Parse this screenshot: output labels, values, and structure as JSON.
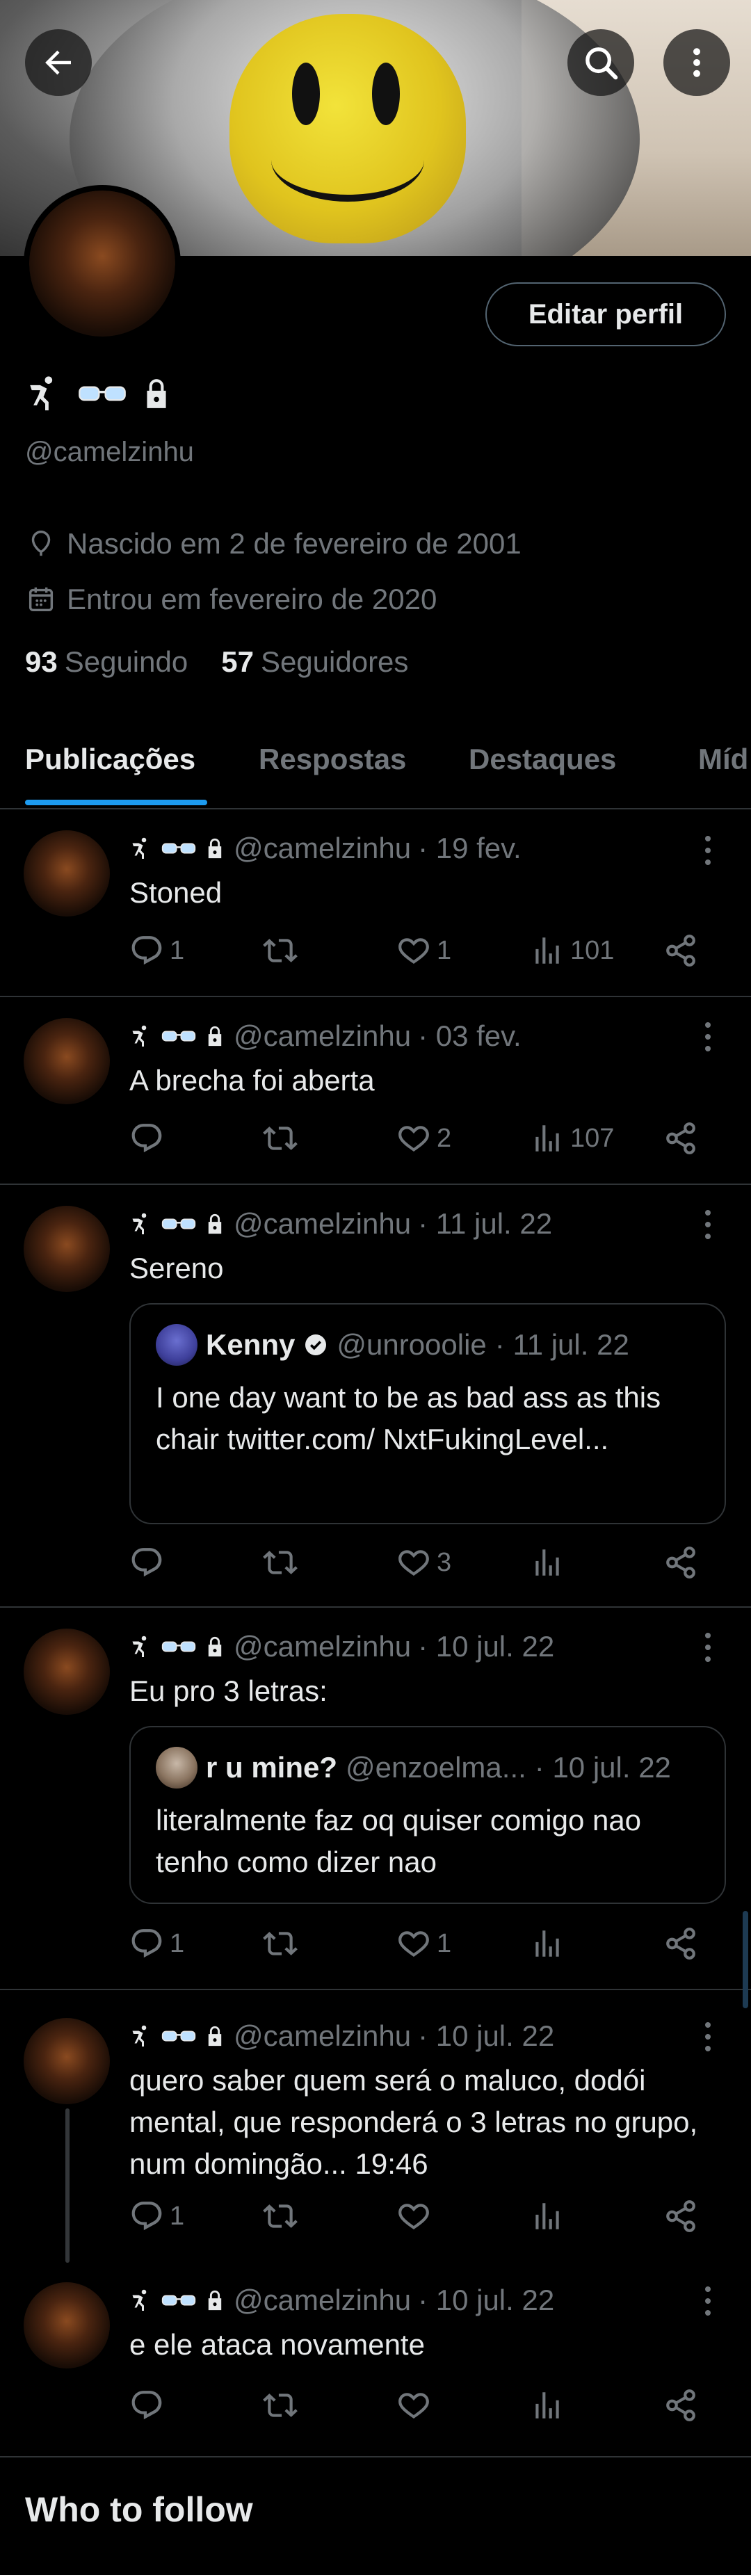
{
  "profile": {
    "display_name_icons": [
      "person-run-icon",
      "glasses-icon",
      "lock-icon"
    ],
    "handle": "@camelzinhu",
    "edit_button": "Editar perfil",
    "birth": "Nascido em 2 de fevereiro de 2001",
    "joined": "Entrou em fevereiro de 2020",
    "following_count": "93",
    "following_label": "Seguindo",
    "followers_count": "57",
    "followers_label": "Seguidores"
  },
  "tabs": [
    "Publicações",
    "Respostas",
    "Destaques",
    "Míd"
  ],
  "posts": [
    {
      "handle": "@camelzinhu",
      "date": "· 19 fev.",
      "text": "Stoned",
      "replies": "1",
      "likes": "1",
      "views": "101"
    },
    {
      "handle": "@camelzinhu",
      "date": "· 03 fev.",
      "text": "A brecha foi aberta",
      "replies": "",
      "likes": "2",
      "views": "107"
    },
    {
      "handle": "@camelzinhu",
      "date": "· 11 jul. 22",
      "text": "Sereno",
      "replies": "",
      "likes": "3",
      "views": "",
      "quote": {
        "name": "Kenny",
        "handle": "@unrooolie",
        "date": "· 11 jul. 22",
        "text": "I one day want to be as bad ass as this chair  twitter.com/ NxtFukingLevel..."
      }
    },
    {
      "handle": "@camelzinhu",
      "date": "· 10 jul. 22",
      "text": "Eu pro 3 letras:",
      "replies": "1",
      "likes": "1",
      "views": "",
      "quote": {
        "name": "r u mine?",
        "handle": "@enzoelma...",
        "date": "· 10 jul. 22",
        "text": "literalmente faz oq quiser comigo nao tenho como dizer nao"
      }
    },
    {
      "handle": "@camelzinhu",
      "date": "· 10 jul. 22",
      "text": "quero saber quem será o maluco, dodói mental, que responderá o 3 letras no grupo, num domingão... 19:46",
      "replies": "1",
      "likes": "",
      "views": ""
    },
    {
      "handle": "@camelzinhu",
      "date": "· 10 jul. 22",
      "text": "e ele ataca novamente",
      "replies": "",
      "likes": "",
      "views": ""
    }
  ],
  "who_to_follow": "Who to follow",
  "colors": {
    "accent": "#1d9bf0",
    "muted": "#71767b",
    "text": "#e7e9ea",
    "border": "#2f3336"
  }
}
